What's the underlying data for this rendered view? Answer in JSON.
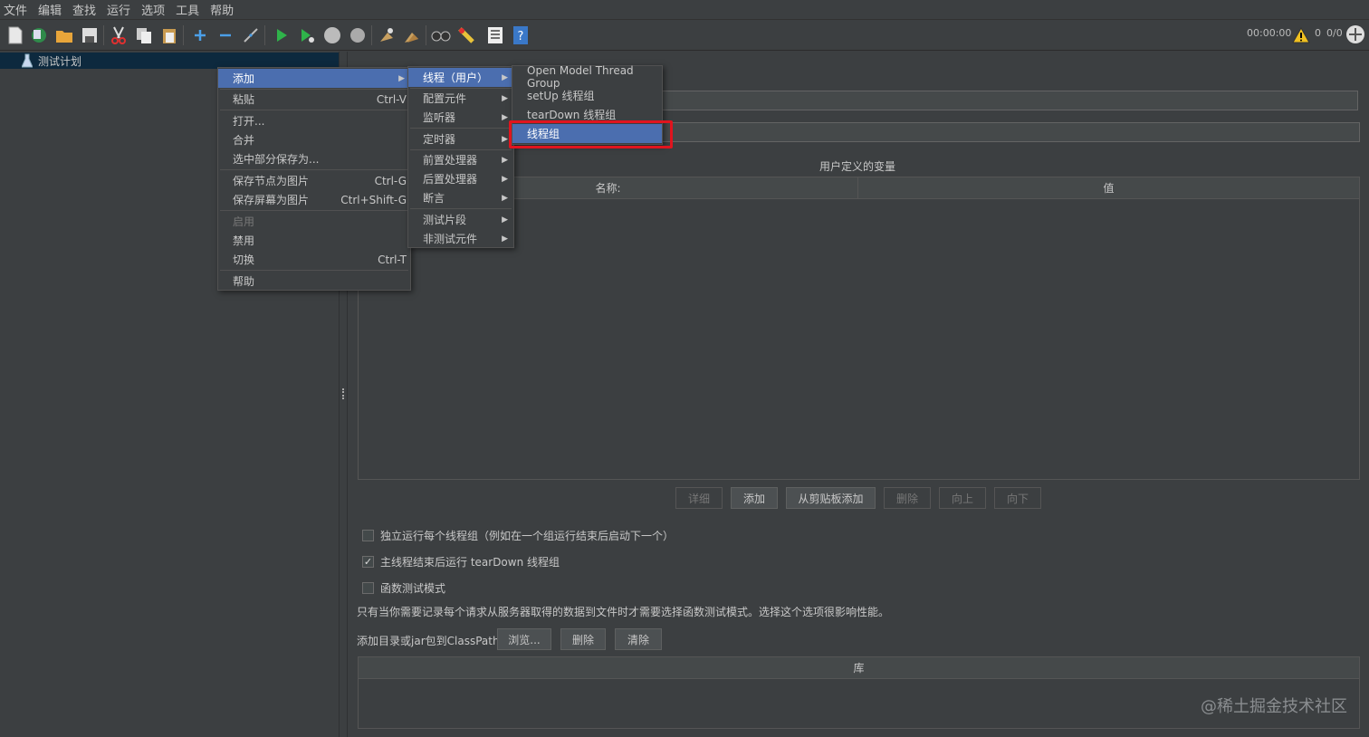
{
  "menubar": [
    "文件",
    "编辑",
    "查找",
    "运行",
    "选项",
    "工具",
    "帮助"
  ],
  "toolbar": {
    "icons": [
      "new-icon",
      "templates-icon",
      "open-icon",
      "save-icon",
      "cut-icon",
      "copy-icon",
      "paste-icon",
      "expand-icon",
      "collapse-icon",
      "toggle-icon",
      "start-icon",
      "start-no-pause-icon",
      "stop-icon",
      "shutdown-icon",
      "clear-icon",
      "clear-all-icon",
      "search-icon",
      "reset-search-icon",
      "function-helper-icon",
      "help-icon"
    ],
    "timer": "00:00:00",
    "warn_count": "0",
    "threads": "0/0"
  },
  "tree": {
    "root_label": "测试计划"
  },
  "form": {
    "section_title": "用户定义的变量",
    "col_name": "名称:",
    "col_value": "值",
    "buttons": [
      "详细",
      "添加",
      "从剪贴板添加",
      "删除",
      "向上",
      "向下"
    ],
    "checks": [
      {
        "label": "独立运行每个线程组（例如在一个组运行结束后启动下一个）",
        "checked": false
      },
      {
        "label": "主线程结束后运行 tearDown 线程组",
        "checked": true
      },
      {
        "label": "函数测试模式",
        "checked": false
      }
    ],
    "note": "只有当你需要记录每个请求从服务器取得的数据到文件时才需要选择函数测试模式。选择这个选项很影响性能。",
    "classpath_label": "添加目录或jar包到ClassPath",
    "classpath_buttons": [
      "浏览...",
      "删除",
      "清除"
    ],
    "lib_header": "库"
  },
  "context_menu": [
    {
      "label": "添加",
      "submenu": true,
      "selected": true
    },
    {
      "label": "粘贴",
      "accel": "Ctrl-V"
    },
    {
      "label": "打开..."
    },
    {
      "label": "合并"
    },
    {
      "label": "选中部分保存为..."
    },
    {
      "label": "保存节点为图片",
      "accel": "Ctrl-G"
    },
    {
      "label": "保存屏幕为图片",
      "accel": "Ctrl+Shift-G"
    },
    {
      "label": "启用",
      "disabled": true
    },
    {
      "label": "禁用"
    },
    {
      "label": "切换",
      "accel": "Ctrl-T"
    },
    {
      "label": "帮助"
    }
  ],
  "submenu_add": [
    {
      "label": "线程（用户）",
      "selected": true
    },
    {
      "label": "配置元件"
    },
    {
      "label": "监听器"
    },
    {
      "label": "定时器"
    },
    {
      "label": "前置处理器"
    },
    {
      "label": "后置处理器"
    },
    {
      "label": "断言"
    },
    {
      "label": "测试片段"
    },
    {
      "label": "非测试元件"
    }
  ],
  "submenu_threads": [
    {
      "label": "Open Model Thread Group"
    },
    {
      "label": "setUp 线程组"
    },
    {
      "label": "tearDown 线程组"
    },
    {
      "label": "线程组",
      "selected": true
    }
  ],
  "watermark": "@稀土掘金技术社区",
  "colors": {
    "selection": "#4b6eaf",
    "highlight": "#e0141e",
    "background": "#3c3f41"
  }
}
